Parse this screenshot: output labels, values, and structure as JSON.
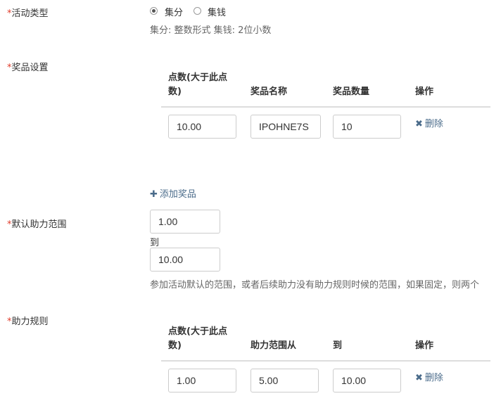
{
  "activity_type": {
    "label": "活动类型",
    "options": [
      {
        "label": "集分",
        "selected": true
      },
      {
        "label": "集钱",
        "selected": false
      }
    ],
    "help": "集分: 整数形式 集钱: 2位小数"
  },
  "prize_settings": {
    "label": "奖品设置",
    "columns": [
      "点数(大于此点",
      "数)",
      "奖品名称",
      "奖品数量",
      "操作"
    ],
    "rows": [
      {
        "points": "10.00",
        "name": "IPOHNE7S",
        "quantity": "10",
        "delete_label": "删除"
      }
    ],
    "add_label": "添加奖品"
  },
  "default_range": {
    "label": "默认助力范围",
    "from": "1.00",
    "to_label": "到",
    "to": "10.00",
    "help": "参加活动默认的范围，或者后续助力没有助力规则时候的范围，如果固定，则两个"
  },
  "assist_rules": {
    "label": "助力规则",
    "columns": [
      "点数(大于此点",
      "数)",
      "助力范围从",
      "到",
      "操作"
    ],
    "rows": [
      {
        "points": "1.00",
        "from": "5.00",
        "to": "10.00",
        "delete_label": "删除"
      }
    ]
  },
  "required_mark": "*",
  "colors": {
    "required": "#e03c2b",
    "link": "#4a6b8a",
    "border": "#cccccc",
    "divider": "#dddddd"
  }
}
